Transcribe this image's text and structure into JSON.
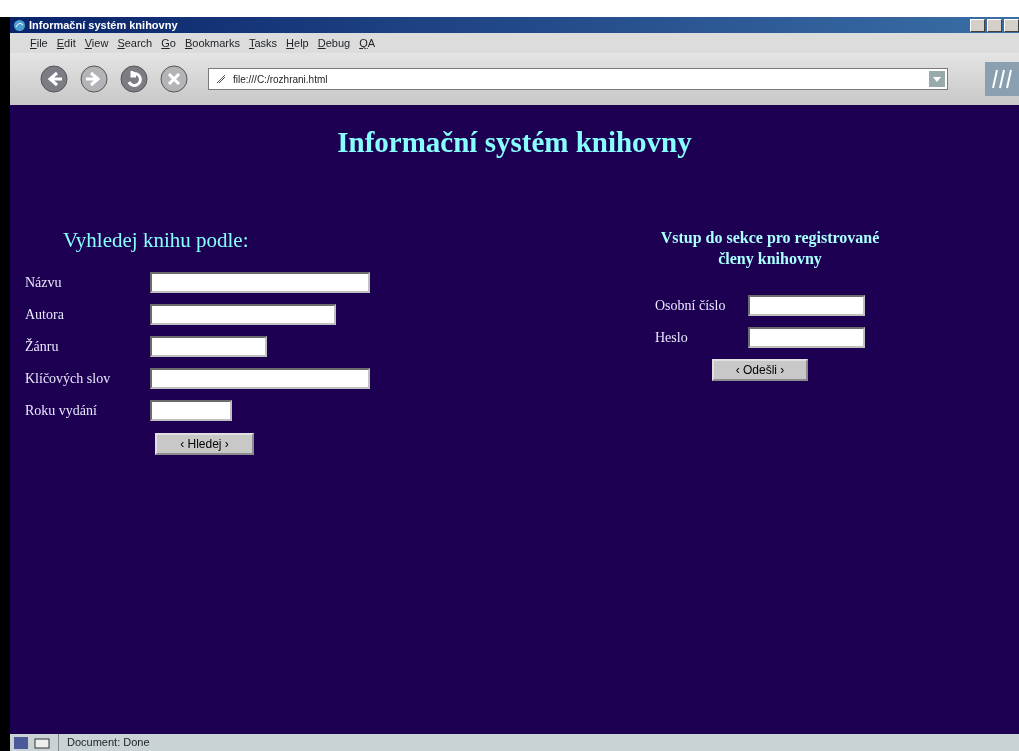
{
  "window": {
    "title": "Informační systém knihovny"
  },
  "menu": [
    "File",
    "Edit",
    "View",
    "Search",
    "Go",
    "Bookmarks",
    "Tasks",
    "Help",
    "Debug",
    "QA"
  ],
  "toolbar_buttons": [
    {
      "kind": "back",
      "disabled": false
    },
    {
      "kind": "forward",
      "disabled": true
    },
    {
      "kind": "reload",
      "disabled": false
    },
    {
      "kind": "stop",
      "disabled": true
    }
  ],
  "address_bar": {
    "value": "file:///C:/rozhrani.html"
  },
  "page": {
    "heading": "Informační systém knihovny",
    "search": {
      "title": "Vyhledej knihu podle:",
      "fields": [
        {
          "label": "Názvu"
        },
        {
          "label": "Autora"
        },
        {
          "label": "Žánru"
        },
        {
          "label": "Klíčových slov"
        },
        {
          "label": "Roku vydání"
        }
      ],
      "button": "‹ Hledej ›"
    },
    "login": {
      "title": "Vstup do sekce pro registrované členy knihovny",
      "fields": [
        {
          "label": "Osobní číslo"
        },
        {
          "label": "Heslo"
        }
      ],
      "button": "‹ Odešli ›"
    }
  },
  "status_bar": {
    "text": "Document: Done"
  }
}
